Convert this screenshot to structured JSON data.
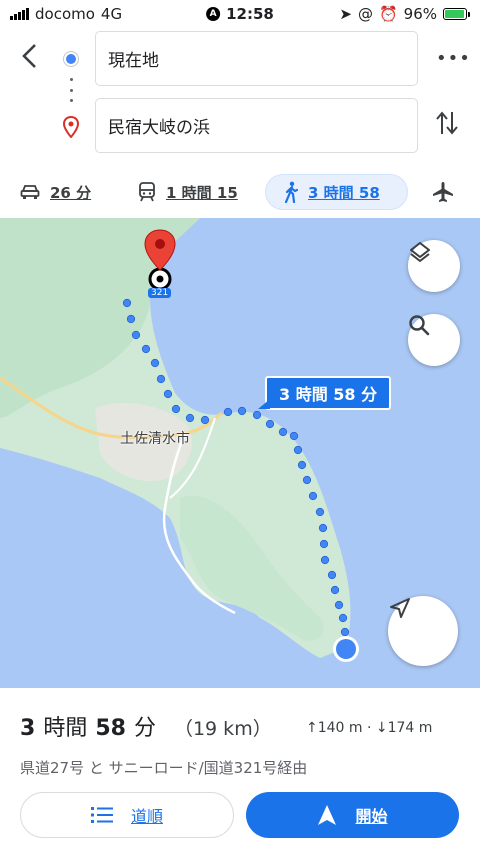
{
  "status_bar": {
    "carrier": "docomo",
    "network": "4G",
    "time": "12:58",
    "battery": "96%"
  },
  "route": {
    "origin": "現在地",
    "destination": "民宿大岐の浜"
  },
  "modes": [
    {
      "icon": "car-icon",
      "label": "26 分"
    },
    {
      "icon": "train-icon",
      "label": "1 時間 15"
    },
    {
      "icon": "walk-icon",
      "label": "3 時間 58",
      "selected": true
    },
    {
      "icon": "airplane-icon",
      "label": ""
    }
  ],
  "map": {
    "route_bubble": "3 時間 58 分",
    "city_label": "土佐清水市",
    "road_number": "321",
    "colors": {
      "sea": "#aac8f5",
      "land": "#cfe9d6",
      "route": "#4285f4",
      "destination_pin": "#ea4335"
    }
  },
  "summary": {
    "time_hours": "3",
    "time_h_unit": "時間",
    "time_minutes": "58",
    "time_m_unit": "分",
    "distance": "（19 km）",
    "elevation": "↑140 m · ↓174 m",
    "via": "県道27号 と サニーロード/国道321号経由"
  },
  "buttons": {
    "steps": "道順",
    "start": "開始"
  }
}
